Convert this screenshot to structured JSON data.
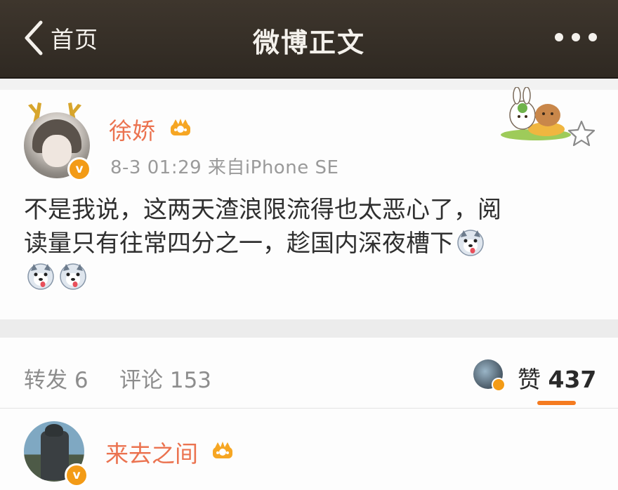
{
  "nav": {
    "back_label": "首页",
    "title": "微博正文"
  },
  "post": {
    "username": "徐娇",
    "meta": "8-3 01:29  来自iPhone SE",
    "text_line1": "不是我说，这两天渣浪限流得也太恶心了，阅",
    "text_line2": "读量只有往常四分之一，趁国内深夜槽下",
    "verified_mark": "v"
  },
  "stats": {
    "repost_label": "转发 6",
    "comment_label": "评论 153",
    "like_label": "赞",
    "like_count": "437"
  },
  "comment": {
    "username": "来去之间",
    "verified_mark": "v"
  },
  "colors": {
    "nav_bg": "#3a332a",
    "username": "#eb7350",
    "verified_badge": "#f39b16",
    "accent_underline": "#f57b20"
  },
  "icons": [
    "back-chevron-icon",
    "more-dots-icon",
    "antler-icon",
    "crown-icon",
    "sticker-icon",
    "star-icon",
    "husky-emoji-icon"
  ]
}
